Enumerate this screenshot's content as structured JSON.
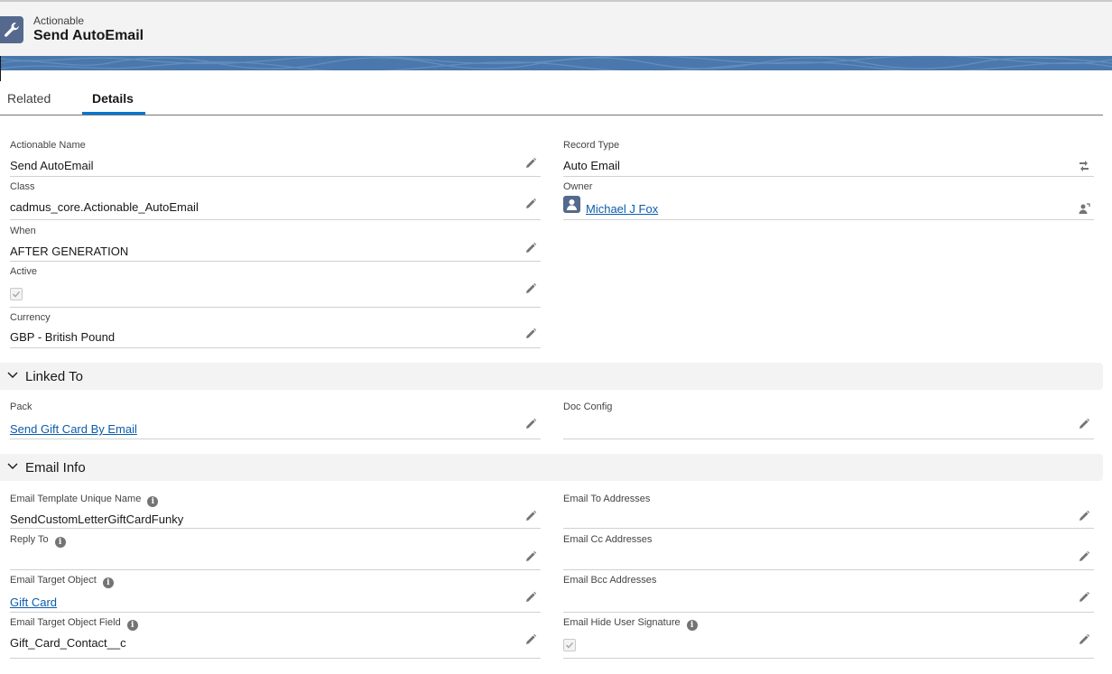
{
  "header": {
    "object_type": "Actionable",
    "record_title": "Send AutoEmail",
    "icon": "wrench-icon"
  },
  "tabs": [
    {
      "label": "Related",
      "active": false
    },
    {
      "label": "Details",
      "active": true
    }
  ],
  "details": {
    "actionable_name": {
      "label": "Actionable Name",
      "value": "Send AutoEmail"
    },
    "record_type": {
      "label": "Record Type",
      "value": "Auto Email"
    },
    "class": {
      "label": "Class",
      "value": "cadmus_core.Actionable_AutoEmail"
    },
    "owner": {
      "label": "Owner",
      "value": "Michael J Fox"
    },
    "when": {
      "label": "When",
      "value": "AFTER GENERATION"
    },
    "active": {
      "label": "Active",
      "checked": true
    },
    "currency": {
      "label": "Currency",
      "value": "GBP - British Pound"
    }
  },
  "linked_to": {
    "title": "Linked To",
    "pack": {
      "label": "Pack",
      "value": "Send Gift Card By Email"
    },
    "doc_config": {
      "label": "Doc Config",
      "value": ""
    }
  },
  "email_info": {
    "title": "Email Info",
    "template_unique_name": {
      "label": "Email Template Unique Name",
      "value": "SendCustomLetterGiftCardFunky"
    },
    "to_addresses": {
      "label": "Email To Addresses",
      "value": ""
    },
    "reply_to": {
      "label": "Reply To",
      "value": ""
    },
    "cc_addresses": {
      "label": "Email Cc Addresses",
      "value": ""
    },
    "target_object": {
      "label": "Email Target Object",
      "value": "Gift Card"
    },
    "bcc_addresses": {
      "label": "Email Bcc Addresses",
      "value": ""
    },
    "target_object_field": {
      "label": "Email Target Object Field",
      "value": "Gift_Card_Contact__c"
    },
    "hide_user_signature": {
      "label": "Email Hide User Signature",
      "checked": true
    }
  },
  "colors": {
    "brand_blue": "#0176d3",
    "link": "#0b5cab",
    "header_bg": "#f3f3f3",
    "banner": "#4a78ad"
  }
}
